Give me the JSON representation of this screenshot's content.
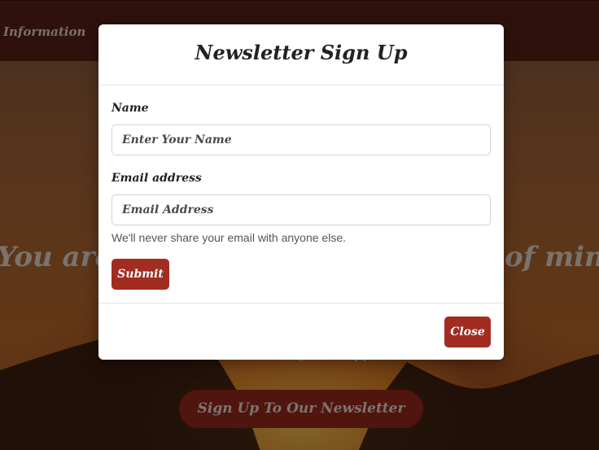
{
  "navbar": {
    "link_label": "Information"
  },
  "hero": {
    "title_left": "You are",
    "title_right": "of mind",
    "subtitle": "All at once in your ...apples.",
    "cta_label": "Sign Up To Our Newsletter"
  },
  "modal": {
    "title": "Newsletter Sign Up",
    "name_label": "Name",
    "name_placeholder": "Enter Your Name",
    "email_label": "Email address",
    "email_placeholder": "Email Address",
    "email_help": "We'll never share your email with anyone else.",
    "submit_label": "Submit",
    "close_label": "Close"
  },
  "colors": {
    "brand": "#a22c20",
    "navbar": "#5e2318",
    "backdrop": "rgba(0,0,0,0.5)"
  }
}
